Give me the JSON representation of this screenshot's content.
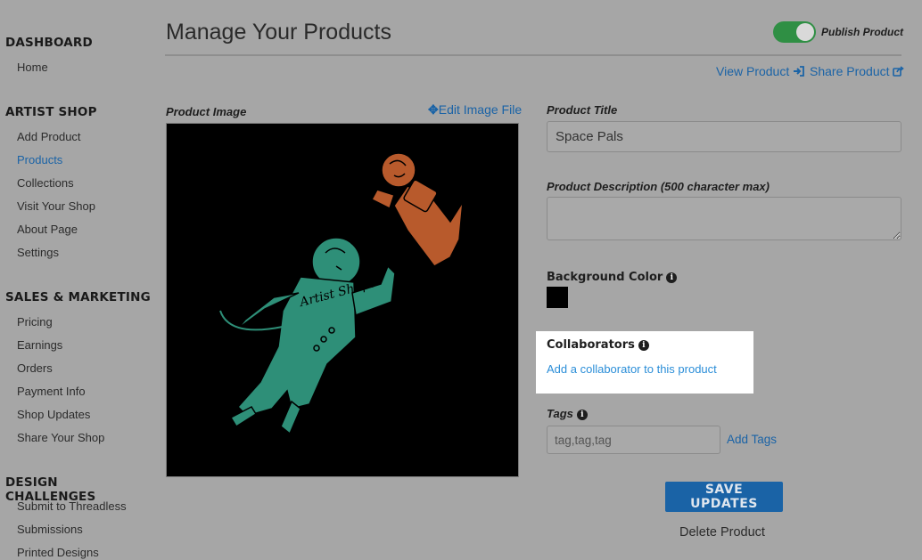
{
  "sidebar": {
    "sections": [
      {
        "title": "DASHBOARD",
        "items": [
          {
            "label": "Home",
            "active": false
          }
        ]
      },
      {
        "title": "ARTIST SHOP",
        "items": [
          {
            "label": "Add Product",
            "active": false
          },
          {
            "label": "Products",
            "active": true
          },
          {
            "label": "Collections",
            "active": false
          },
          {
            "label": "Visit Your Shop",
            "active": false
          },
          {
            "label": "About Page",
            "active": false
          },
          {
            "label": "Settings",
            "active": false
          }
        ]
      },
      {
        "title": "SALES & MARKETING",
        "items": [
          {
            "label": "Pricing",
            "active": false
          },
          {
            "label": "Earnings",
            "active": false
          },
          {
            "label": "Orders",
            "active": false
          },
          {
            "label": "Payment Info",
            "active": false
          },
          {
            "label": "Shop Updates",
            "active": false
          },
          {
            "label": "Share Your Shop",
            "active": false
          }
        ]
      },
      {
        "title": "DESIGN CHALLENGES",
        "items": [
          {
            "label": "Submit to Threadless",
            "active": false
          },
          {
            "label": "Submissions",
            "active": false
          },
          {
            "label": "Printed Designs",
            "active": false
          }
        ]
      }
    ]
  },
  "header": {
    "title": "Manage Your Products",
    "publish_label": "Publish Product",
    "publish_on": true,
    "view_product": "View Product",
    "share_product": "Share Product"
  },
  "image_panel": {
    "label": "Product Image",
    "edit_link": "Edit Image File",
    "design_text": "Artist Shops"
  },
  "form": {
    "title_label": "Product Title",
    "title_value": "Space Pals",
    "description_label": "Product Description (500 character max)",
    "description_value": "",
    "bg_color_label": "Background Color",
    "bg_color": "#000000",
    "collaborators_label": "Collaborators",
    "add_collaborator": "Add a collaborator to this product",
    "tags_label": "Tags",
    "tags_placeholder": "tag,tag,tag",
    "add_tags": "Add Tags",
    "save_button": "SAVE UPDATES",
    "delete_link": "Delete Product"
  },
  "colors": {
    "accent": "#1a63a6",
    "toggle_on": "#2f8f44",
    "astronaut": "#2e8f78",
    "dog": "#b85a2c"
  }
}
